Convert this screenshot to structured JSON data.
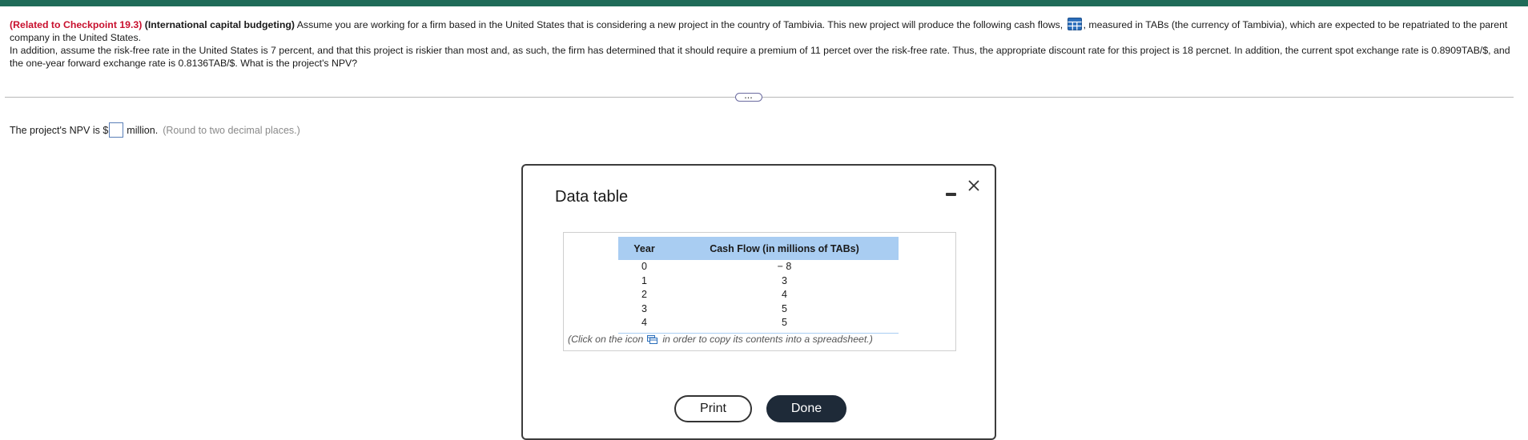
{
  "question": {
    "ref": "(Related to Checkpoint 19.3)",
    "topic": "(International capital budgeting)",
    "text_part1": "Assume you are working for a firm based in the United States that is considering a new project in the country of Tambivia.  This new project will produce the following cash flows,",
    "text_part2": ", measured in TABs (the currency of Tambivia), which are expected to be repatriated to the parent company in the United States.",
    "text_part3": "In addition, assume the risk-free rate in the United States is 7 percent, and that this project is riskier than most and, as such, the firm has determined that it should require a premium of 11 percet over the risk-free rate.  Thus, the appropriate discount rate for this project is 18 percnet.  In addition, the current spot exchange rate is 0.8909TAB/$, and the one-year forward exchange rate is 0.8136TAB/$.  What is the project's NPV?"
  },
  "expand_label": "...",
  "answer": {
    "prefix": "The project's NPV is $",
    "suffix": "million.",
    "hint": "(Round to two decimal places.)",
    "value": ""
  },
  "dialog": {
    "title": "Data table",
    "table": {
      "headers": [
        "Year",
        "Cash Flow (in millions of TABs)"
      ],
      "rows": [
        [
          "0",
          "− 8"
        ],
        [
          "1",
          "3"
        ],
        [
          "2",
          "4"
        ],
        [
          "3",
          "5"
        ],
        [
          "4",
          "5"
        ]
      ]
    },
    "note_before": "(Click on the icon",
    "note_after": "in order to copy its contents into a spreadsheet.)",
    "print_label": "Print",
    "done_label": "Done"
  },
  "colors": {
    "top_bar": "#1f6b58",
    "ref_red": "#c8102e",
    "table_header": "#a9cdf2",
    "done_button": "#1e2a38"
  },
  "icons": [
    "table-icon",
    "copy-icon",
    "minimize-icon",
    "close-icon"
  ]
}
